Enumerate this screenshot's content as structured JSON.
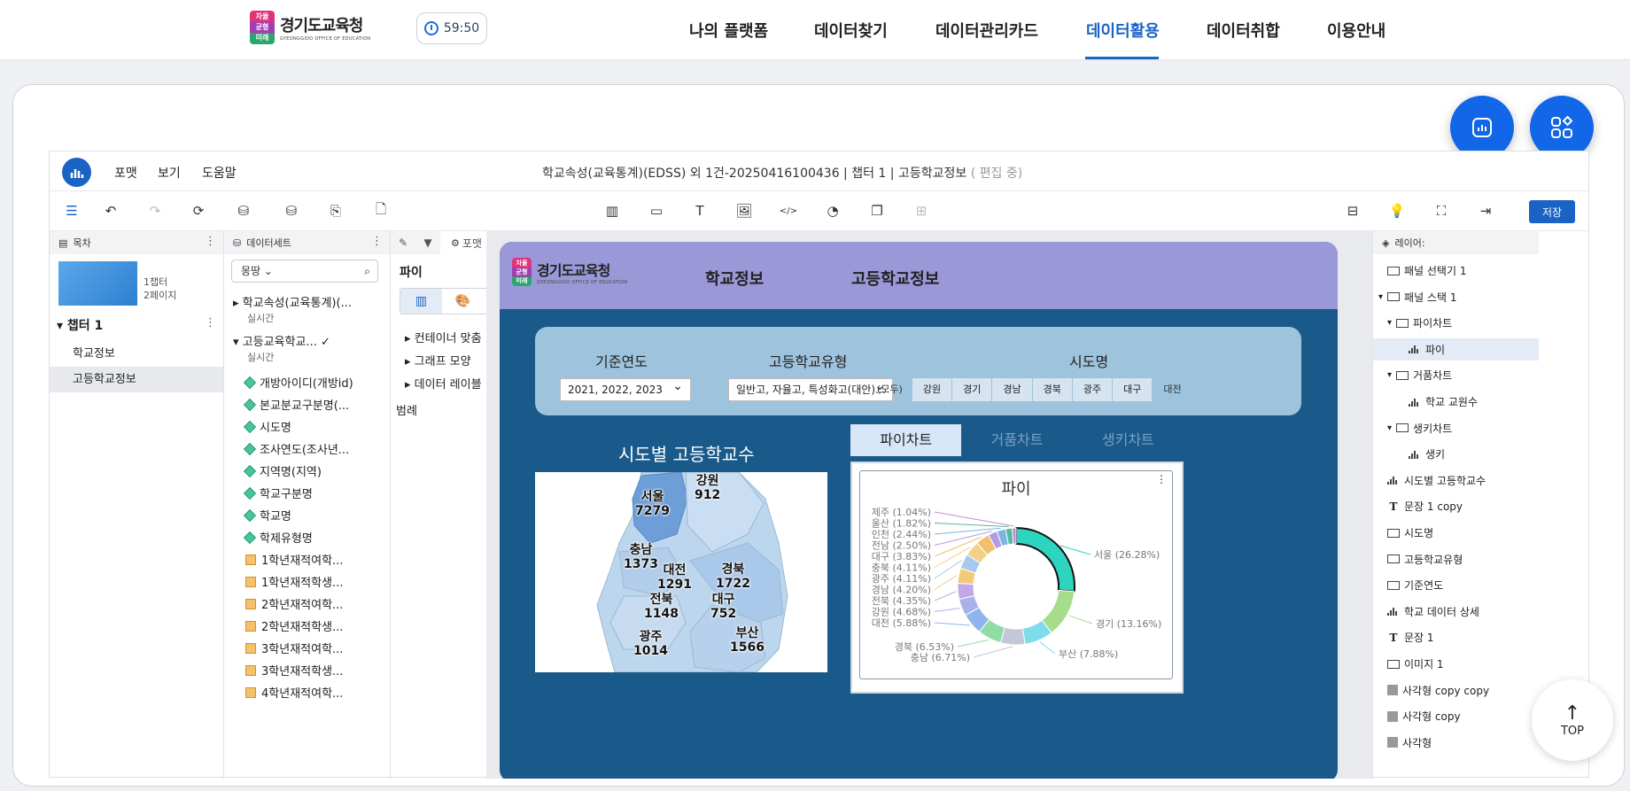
{
  "header": {
    "logo_badge": "자율 균형 미래",
    "logo_title": "경기도교육청",
    "logo_subtitle": "GYEONGGIDO OFFICE OF EDUCATION",
    "timer": "59:50",
    "nav": [
      "나의 플랫폼",
      "데이터찾기",
      "데이터관리카드",
      "데이터활용",
      "데이터취합",
      "이용안내"
    ],
    "active_nav": "데이터활용"
  },
  "fab": {
    "top_label": "TOP"
  },
  "editor": {
    "menu": [
      "포맷",
      "보기",
      "도움말"
    ],
    "doc_title": "학교속성(교육통계)(EDSS) 외 1건-20250416100436 | 챕터 1 | 고등학교정보",
    "doc_edit": "( 편집 중)",
    "save_label": "저장"
  },
  "toc": {
    "header": "목차",
    "meta1": "1챕터",
    "meta2": "2페이지",
    "chapter": "챕터 1",
    "pages": [
      "학교정보",
      "고등학교정보"
    ]
  },
  "dataset": {
    "header": "데이터세트",
    "search": "몽땅",
    "ds1": "학교속성(교육통계)(...",
    "ds1_sub": "실시간",
    "ds2": "고등교육학교...",
    "ds2_sub": "실시간",
    "fields": [
      "개방아이디(개방id)",
      "본교분교구분명(...",
      "시도명",
      "조사연도(조사년...",
      "지역명(지역)",
      "학교구분명",
      "학교명",
      "학제유형명"
    ],
    "measures": [
      "1학년재적여학...",
      "1학년재적학생...",
      "2학년재적여학...",
      "2학년재적학생...",
      "3학년재적여학...",
      "3학년재적학생...",
      "4학년재적여학..."
    ]
  },
  "format": {
    "tab_label": "포맷",
    "title": "파이",
    "rows": [
      "컨테이너 맞춤",
      "그래프 모양",
      "데이터 레이블",
      "범례"
    ]
  },
  "dashboard": {
    "logo_badge": "자율 균형 미래",
    "logo_title": "경기도교육청",
    "logo_subtitle": "GYEONGGIDO OFFICE OF EDUCATION",
    "tabs": [
      "학교정보",
      "고등학교정보"
    ],
    "filters": {
      "year_label": "기준연도",
      "year_value": "2021, 2022, 2023",
      "type_label": "고등학교유형",
      "type_value": "일반고, 자율고, 특성화고(대안)...",
      "sido_label": "시도명",
      "sido_items": [
        "(모두)",
        "강원",
        "경기",
        "경남",
        "경북",
        "광주",
        "대구",
        "대전"
      ]
    },
    "map_title": "시도별 고등학교수",
    "map_labels": [
      {
        "name": "서울",
        "value": "7279"
      },
      {
        "name": "강원",
        "value": "912"
      },
      {
        "name": "충남",
        "value": "1373"
      },
      {
        "name": "대전",
        "value": "1291"
      },
      {
        "name": "경북",
        "value": "1722"
      },
      {
        "name": "전북",
        "value": "1148"
      },
      {
        "name": "대구",
        "value": "752"
      },
      {
        "name": "광주",
        "value": "1014"
      },
      {
        "name": "부산",
        "value": "1566"
      }
    ],
    "chart_tabs": [
      "파이차트",
      "거품차트",
      "생키차트"
    ],
    "pie_title": "파이"
  },
  "chart_data": {
    "type": "pie",
    "title": "파이",
    "categories": [
      "서울",
      "경기",
      "부산",
      "충남",
      "경북",
      "대전",
      "강원",
      "전북",
      "경남",
      "광주",
      "충북",
      "대구",
      "전남",
      "인천",
      "울산",
      "제주"
    ],
    "values": [
      26.28,
      13.16,
      7.88,
      6.71,
      6.53,
      5.88,
      4.68,
      4.35,
      4.2,
      4.11,
      4.11,
      3.83,
      2.5,
      2.44,
      1.82,
      1.04
    ],
    "labels": [
      "서울 (26.28%)",
      "경기 (13.16%)",
      "부산 (7.88%)",
      "충남 (6.71%)",
      "경북 (6.53%)",
      "대전 (5.88%)",
      "강원 (4.68%)",
      "전북 (4.35%)",
      "경남 (4.20%)",
      "광주 (4.11%)",
      "충북 (4.11%)",
      "대구 (3.83%)",
      "전남 (2.50%)",
      "인천 (2.44%)",
      "울산 (1.82%)",
      "제주 (1.04%)"
    ],
    "colors": [
      "#2dd4bf",
      "#a7dc8a",
      "#7fdcec",
      "#c3c7d6",
      "#8fdca4",
      "#8fb4ee",
      "#a9b1ea",
      "#c2a8e8",
      "#f5c97a",
      "#a6c9ee",
      "#f2d088",
      "#f0c070",
      "#b49be6",
      "#7ab6e0",
      "#55b8a0",
      "#c08ad8"
    ],
    "donut": true
  },
  "layers": {
    "header": "레이어:",
    "items": [
      "패널 선택기 1",
      "패널 스택 1",
      "파이차트",
      "파이",
      "거품차트",
      "학교 교원수",
      "생키차트",
      "생키",
      "시도별 고등학교수",
      "문장 1 copy",
      "시도명",
      "고등학교유형",
      "기준연도",
      "학교 데이터 상세",
      "문장 1",
      "이미지 1",
      "사각형 copy copy",
      "사각형 copy",
      "사각형"
    ]
  }
}
